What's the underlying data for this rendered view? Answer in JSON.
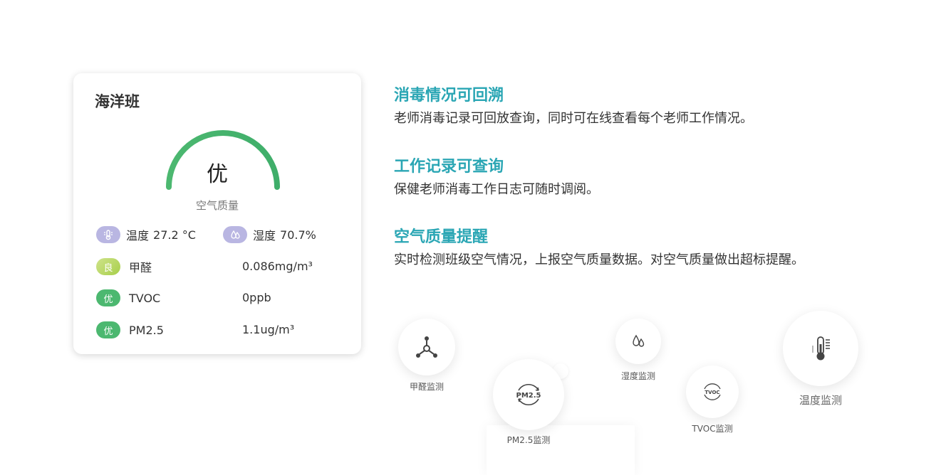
{
  "card": {
    "class_name": "海洋班",
    "grade": "优",
    "gauge_label": "空气质量",
    "temperature": {
      "label": "温度",
      "value": "27.2 °C"
    },
    "humidity": {
      "label": "湿度",
      "value": "70.7%"
    },
    "items": [
      {
        "badge": "良",
        "name": "甲醛",
        "value": "0.086mg/m³"
      },
      {
        "badge": "优",
        "name": "TVOC",
        "value": "0ppb"
      },
      {
        "badge": "优",
        "name": "PM2.5",
        "value": "1.1ug/m³"
      }
    ]
  },
  "features": [
    {
      "title": "消毒情况可回溯",
      "desc": "老师消毒记录可回放查询，同时可在线查看每个老师工作情况。"
    },
    {
      "title": "工作记录可查询",
      "desc": "保健老师消毒工作日志可随时调阅。"
    },
    {
      "title": "空气质量提醒",
      "desc": "实时检测班级空气情况，上报空气质量数据。对空气质量做出超标提醒。"
    }
  ],
  "monitors": {
    "formaldehyde": {
      "label": "甲醛监测",
      "icon": "molecule-icon"
    },
    "pm25": {
      "label": "PM2.5监测",
      "icon_text": "PM2.5",
      "icon": "pm25-icon"
    },
    "humidity": {
      "label": "湿度监测",
      "icon": "water-drops-icon"
    },
    "tvoc": {
      "label": "TVOC监测",
      "icon_text": "TVOC",
      "icon": "tvoc-icon"
    },
    "temperature": {
      "label": "温度监测",
      "icon": "thermometer-icon"
    }
  },
  "colors": {
    "accent_teal": "#2aa6b4",
    "gauge_green": "#4cb870",
    "badge_yellow": "#b5d65a",
    "badge_purple": "#b9b6e2"
  }
}
